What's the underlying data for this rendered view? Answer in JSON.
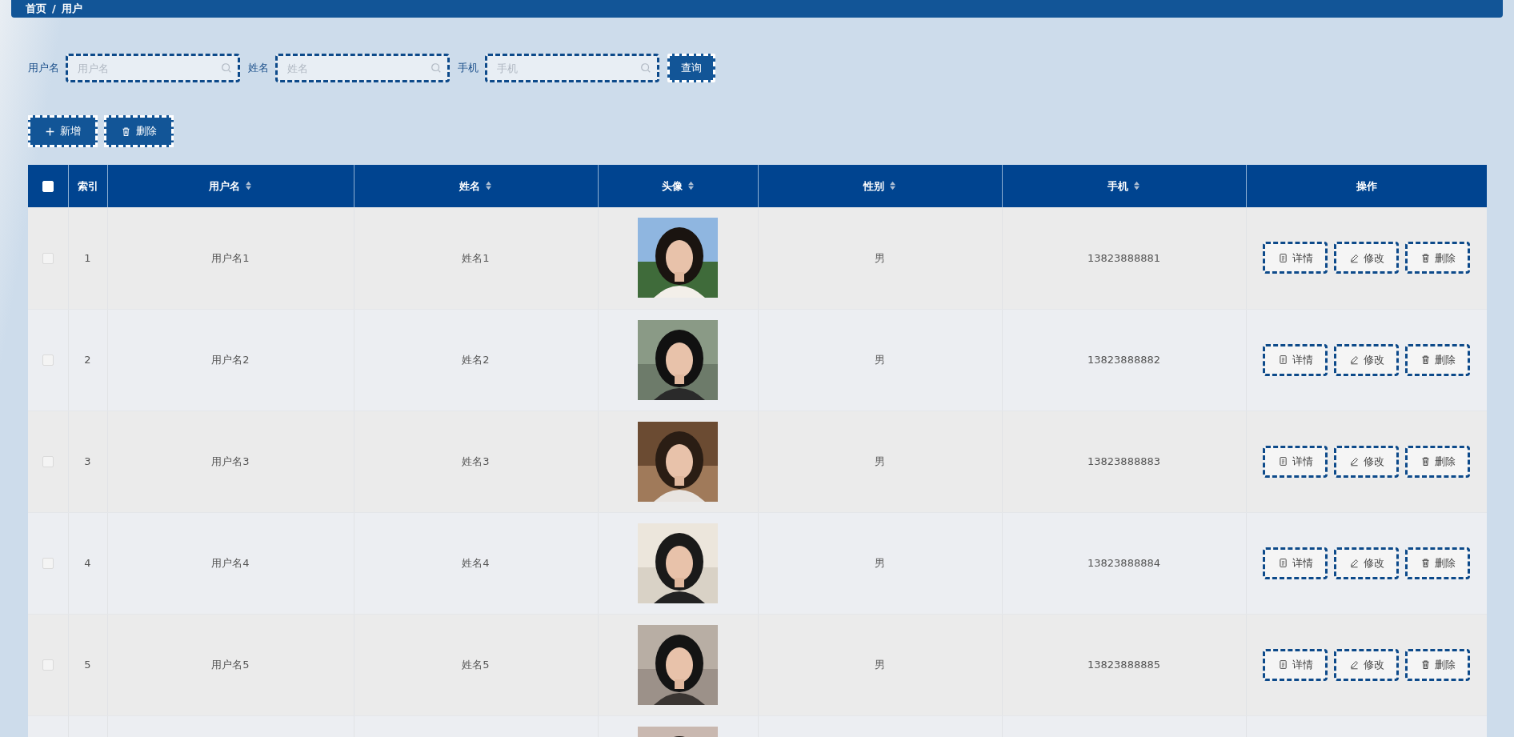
{
  "breadcrumb": {
    "items": [
      {
        "label": "首页"
      },
      {
        "label": "用户"
      }
    ],
    "separator": "/"
  },
  "search": {
    "fields": [
      {
        "label": "用户名",
        "placeholder": "用户名"
      },
      {
        "label": "姓名",
        "placeholder": "姓名"
      },
      {
        "label": "手机",
        "placeholder": "手机"
      }
    ],
    "button": "查询"
  },
  "toolbar": [
    {
      "kind": "add",
      "label": "新增"
    },
    {
      "kind": "delete",
      "label": "删除"
    }
  ],
  "table": {
    "select_all": {
      "checked": false
    },
    "columns": [
      {
        "label": "索引",
        "sortable": false
      },
      {
        "label": "用户名",
        "sortable": true
      },
      {
        "label": "姓名",
        "sortable": true
      },
      {
        "label": "头像",
        "sortable": true
      },
      {
        "label": "性别",
        "sortable": true
      },
      {
        "label": "手机",
        "sortable": true
      },
      {
        "label": "操作",
        "sortable": false
      }
    ],
    "rows": [
      {
        "checked": false,
        "index": "1",
        "username": "用户名1",
        "name": "姓名1",
        "avatar": {
          "kind": "picture"
        },
        "gender": "男",
        "phone": "13823888881",
        "actions": [
          {
            "kind": "detail",
            "label": "详情"
          },
          {
            "kind": "edit",
            "label": "修改"
          },
          {
            "kind": "delete",
            "label": "删除"
          }
        ]
      },
      {
        "checked": false,
        "index": "2",
        "username": "用户名2",
        "name": "姓名2",
        "avatar": {
          "kind": "picture"
        },
        "gender": "男",
        "phone": "13823888882",
        "actions": [
          {
            "kind": "detail",
            "label": "详情"
          },
          {
            "kind": "edit",
            "label": "修改"
          },
          {
            "kind": "delete",
            "label": "删除"
          }
        ]
      },
      {
        "checked": false,
        "index": "3",
        "username": "用户名3",
        "name": "姓名3",
        "avatar": {
          "kind": "picture"
        },
        "gender": "男",
        "phone": "13823888883",
        "actions": [
          {
            "kind": "detail",
            "label": "详情"
          },
          {
            "kind": "edit",
            "label": "修改"
          },
          {
            "kind": "delete",
            "label": "删除"
          }
        ]
      },
      {
        "checked": false,
        "index": "4",
        "username": "用户名4",
        "name": "姓名4",
        "avatar": {
          "kind": "picture"
        },
        "gender": "男",
        "phone": "13823888884",
        "actions": [
          {
            "kind": "detail",
            "label": "详情"
          },
          {
            "kind": "edit",
            "label": "修改"
          },
          {
            "kind": "delete",
            "label": "删除"
          }
        ]
      },
      {
        "checked": false,
        "index": "5",
        "username": "用户名5",
        "name": "姓名5",
        "avatar": {
          "kind": "picture"
        },
        "gender": "男",
        "phone": "13823888885",
        "actions": [
          {
            "kind": "detail",
            "label": "详情"
          },
          {
            "kind": "edit",
            "label": "修改"
          },
          {
            "kind": "delete",
            "label": "删除"
          }
        ]
      },
      {
        "avatar": {
          "kind": "picture"
        }
      }
    ]
  }
}
